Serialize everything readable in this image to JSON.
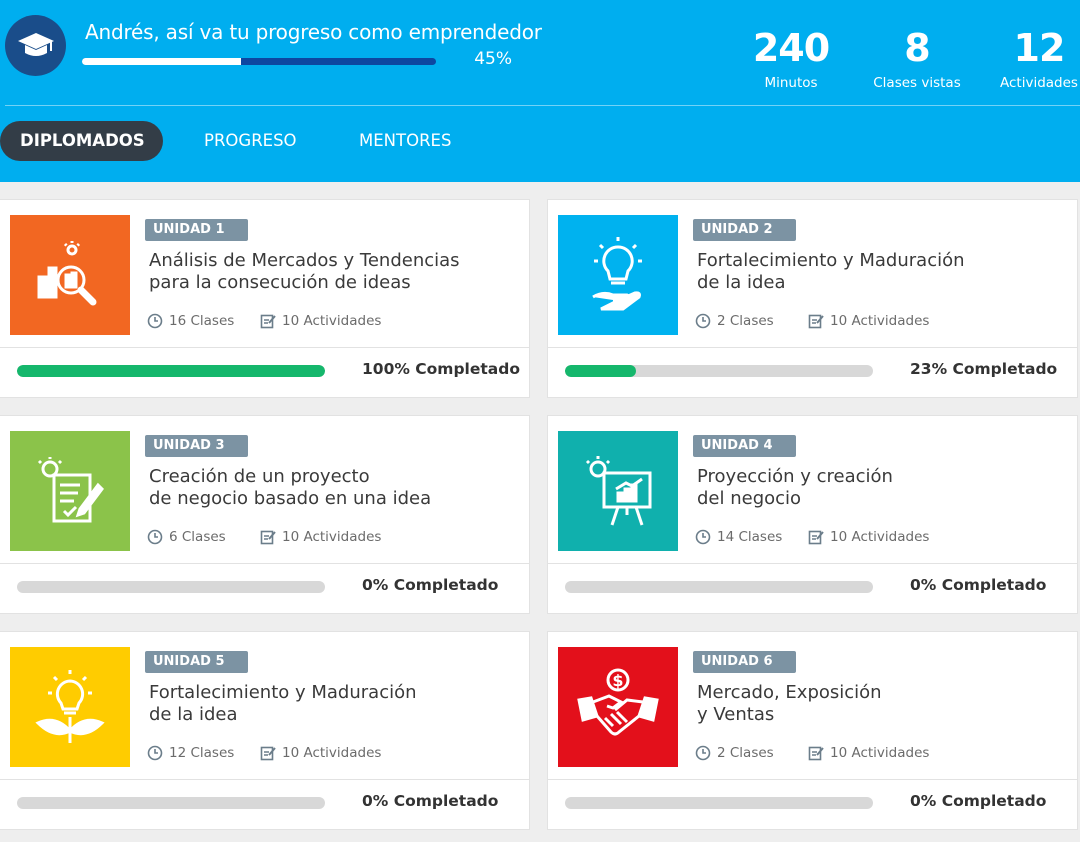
{
  "header": {
    "greeting": "Andrés, así va tu progreso como emprendedor",
    "progress_value": 0.45,
    "progress_label": "45%",
    "stats": [
      {
        "value": "240",
        "label": "Minutos"
      },
      {
        "value": "8",
        "label": "Clases vistas"
      },
      {
        "value": "12",
        "label": "Actividades"
      }
    ],
    "tabs": [
      {
        "label": "DIPLOMADOS"
      },
      {
        "label": "PROGRESO"
      },
      {
        "label": "MENTORES"
      }
    ]
  },
  "units": [
    {
      "badge": "UNIDAD 1",
      "title": "Análisis de Mercados y Tendencias\npara la consecución de ideas",
      "classes": "16 Clases",
      "activities": "10 Actividades",
      "progress_value": 1.0,
      "progress_label": "100% Completado",
      "color": "#f26722",
      "icon": "market-analysis-icon"
    },
    {
      "badge": "UNIDAD 2",
      "title": "Fortalecimiento y Maduración\nde la idea",
      "classes": "2 Clases",
      "activities": "10 Actividades",
      "progress_value": 0.23,
      "progress_label": "23% Completado",
      "color": "#00b2ef",
      "icon": "idea-hand-icon"
    },
    {
      "badge": "UNIDAD 3",
      "title": "Creación de un proyecto\nde negocio basado en una idea",
      "classes": "6 Clases",
      "activities": "10 Actividades",
      "progress_value": 0,
      "progress_label": "0% Completado",
      "color": "#8bc34a",
      "icon": "idea-document-icon"
    },
    {
      "badge": "UNIDAD 4",
      "title": "Proyección y creación\ndel negocio",
      "classes": "14 Clases",
      "activities": "10 Actividades",
      "progress_value": 0,
      "progress_label": "0% Completado",
      "color": "#10b0ad",
      "icon": "presentation-board-icon"
    },
    {
      "badge": "UNIDAD 5",
      "title": "Fortalecimiento y Maduración\nde la idea",
      "classes": "12 Clases",
      "activities": "10 Actividades",
      "progress_value": 0,
      "progress_label": "0% Completado",
      "color": "#ffcc00",
      "icon": "idea-plant-icon"
    },
    {
      "badge": "UNIDAD 6",
      "title": "Mercado, Exposición\ny Ventas",
      "classes": "2 Clases",
      "activities": "10 Actividades",
      "progress_value": 0,
      "progress_label": "0% Completado",
      "color": "#e3101b",
      "icon": "handshake-dollar-icon"
    }
  ],
  "colors": {
    "header_bg": "#00aeef",
    "active_tab_bg": "#333d47",
    "progress_fill": "#15b76c",
    "badge_bg": "#7c93a3"
  }
}
